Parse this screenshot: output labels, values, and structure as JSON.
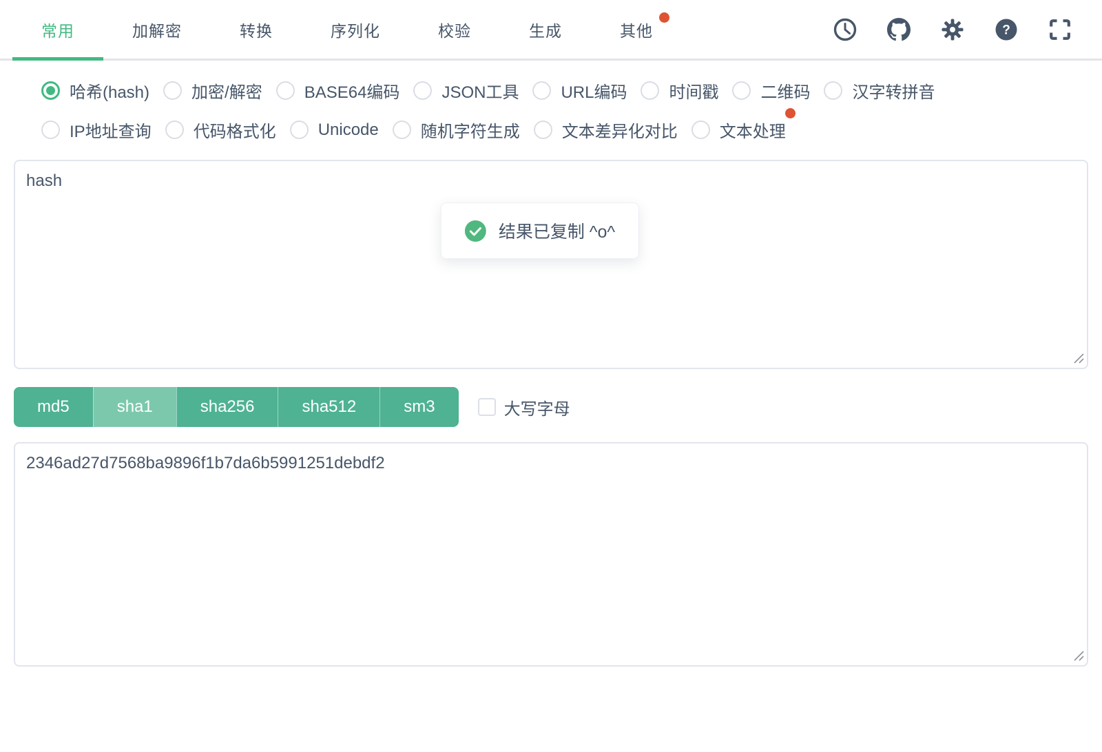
{
  "header": {
    "tabs": [
      {
        "label": "常用",
        "active": true,
        "badge_dot": false
      },
      {
        "label": "加解密",
        "active": false,
        "badge_dot": false
      },
      {
        "label": "转换",
        "active": false,
        "badge_dot": false
      },
      {
        "label": "序列化",
        "active": false,
        "badge_dot": false
      },
      {
        "label": "校验",
        "active": false,
        "badge_dot": false
      },
      {
        "label": "生成",
        "active": false,
        "badge_dot": false
      },
      {
        "label": "其他",
        "active": false,
        "badge_dot": true
      }
    ],
    "icons": [
      "history-clock-icon",
      "github-icon",
      "settings-gear-icon",
      "help-question-icon",
      "fullscreen-icon"
    ]
  },
  "tools": {
    "items": [
      {
        "label": "哈希(hash)",
        "selected": true,
        "badge_dot": false
      },
      {
        "label": "加密/解密",
        "selected": false,
        "badge_dot": false
      },
      {
        "label": "BASE64编码",
        "selected": false,
        "badge_dot": false
      },
      {
        "label": "JSON工具",
        "selected": false,
        "badge_dot": false
      },
      {
        "label": "URL编码",
        "selected": false,
        "badge_dot": false
      },
      {
        "label": "时间戳",
        "selected": false,
        "badge_dot": false
      },
      {
        "label": "二维码",
        "selected": false,
        "badge_dot": false
      },
      {
        "label": "汉字转拼音",
        "selected": false,
        "badge_dot": false
      },
      {
        "label": "IP地址查询",
        "selected": false,
        "badge_dot": false
      },
      {
        "label": "代码格式化",
        "selected": false,
        "badge_dot": false
      },
      {
        "label": "Unicode",
        "selected": false,
        "badge_dot": false
      },
      {
        "label": "随机字符生成",
        "selected": false,
        "badge_dot": false
      },
      {
        "label": "文本差异化对比",
        "selected": false,
        "badge_dot": false
      },
      {
        "label": "文本处理",
        "selected": false,
        "badge_dot": true
      }
    ]
  },
  "hash_tool": {
    "input_value": "hash",
    "algorithms": [
      {
        "label": "md5",
        "active": false
      },
      {
        "label": "sha1",
        "active": true
      },
      {
        "label": "sha256",
        "active": false
      },
      {
        "label": "sha512",
        "active": false
      },
      {
        "label": "sm3",
        "active": false
      }
    ],
    "uppercase_label": "大写字母",
    "uppercase_checked": false,
    "output_value": "2346ad27d7568ba9896f1b7da6b5991251debdf2"
  },
  "toast": {
    "message": "结果已复制 ^o^",
    "icon": "success-check-icon"
  },
  "colors": {
    "accent_green": "#42b983",
    "button_green": "#4fb292",
    "button_active_green": "#7cc8ad",
    "toast_check_green": "#50b87e",
    "badge_red": "#df5333",
    "text_slate": "#475669",
    "border_gray": "#e2e5ec"
  }
}
